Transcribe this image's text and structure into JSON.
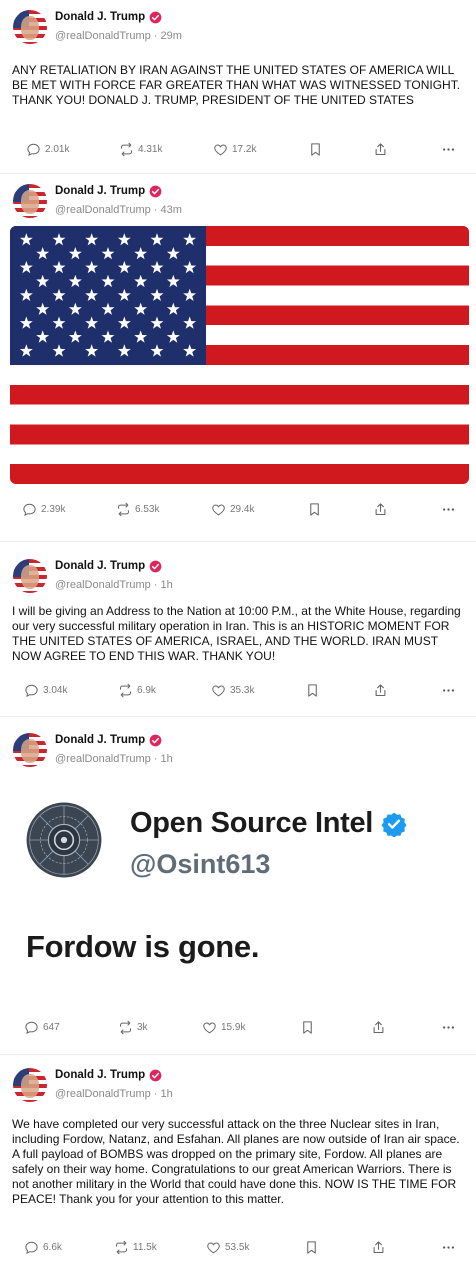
{
  "account": {
    "name": "Donald J. Trump",
    "handle": "@realDonaldTrump"
  },
  "posts": [
    {
      "time": "29m",
      "text": "ANY RETALIATION BY IRAN AGAINST THE UNITED STATES OF AMERICA WILL BE MET WITH FORCE FAR GREATER THAN WHAT WAS WITNESSED TONIGHT. THANK YOU! DONALD J. TRUMP, PRESIDENT OF THE UNITED STATES",
      "replies": "2.01k",
      "reposts": "4.31k",
      "likes": "17.2k"
    },
    {
      "time": "43m",
      "media": "american-flag-image",
      "replies": "2.39k",
      "reposts": "6.53k",
      "likes": "29.4k"
    },
    {
      "time": "1h",
      "text": "I will be giving an Address to the Nation at 10:00 P.M., at the White House, regarding our very successful military operation in Iran. This is an HISTORIC MOMENT FOR THE UNITED STATES OF AMERICA, ISRAEL, AND THE WORLD. IRAN MUST NOW AGREE TO END THIS WAR. THANK YOU!",
      "replies": "3.04k",
      "reposts": "6.9k",
      "likes": "35.3k"
    },
    {
      "time": "1h",
      "embed": {
        "name": "Open Source Intel",
        "handle": "@Osint613",
        "text": "Fordow is gone."
      },
      "replies": "647",
      "reposts": "3k",
      "likes": "15.9k"
    },
    {
      "time": "1h",
      "text": "We have completed our very successful attack on the three Nuclear sites in Iran, including Fordow, Natanz, and Esfahan. All planes are now outside of Iran air space. A full payload of BOMBS was dropped on the primary site, Fordow. All planes are safely on their way home. Congratulations to our great American Warriors. There is not another military in the World that could have done this. NOW IS THE TIME FOR PEACE! Thank you for your attention to this matter.",
      "replies": "6.6k",
      "reposts": "11.5k",
      "likes": "53.5k"
    }
  ],
  "icons": {
    "reply": "reply-icon",
    "repost": "repost-icon",
    "like": "heart-icon",
    "bookmark": "bookmark-icon",
    "share": "share-icon",
    "more": "more-icon",
    "verified": "verified-badge-icon"
  },
  "colors": {
    "verified_badge": "#e0245e",
    "osint_verified": "#1d9bf0",
    "flag_red": "#d0191f",
    "flag_blue": "#1f2f6b"
  }
}
